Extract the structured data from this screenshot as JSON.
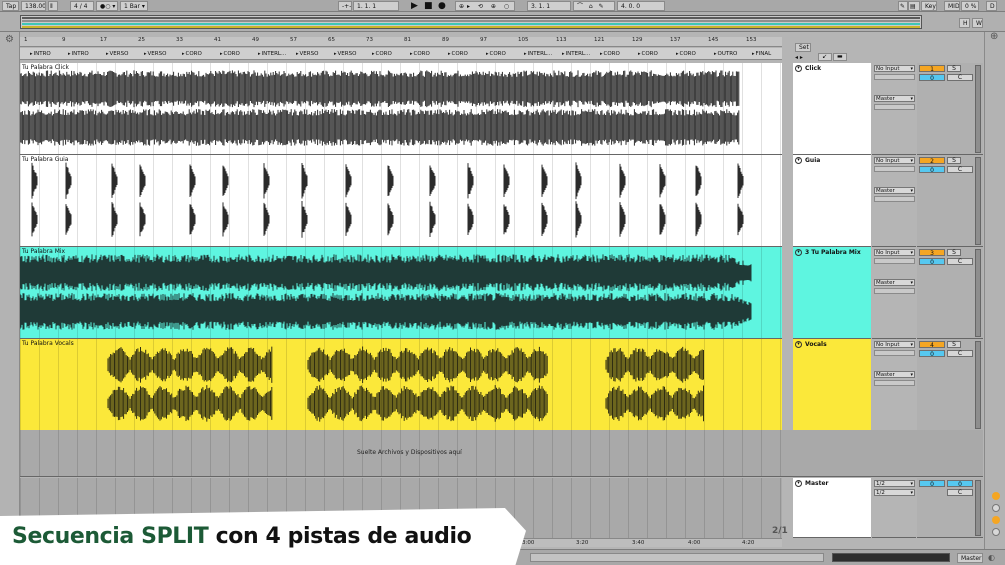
{
  "transport": {
    "tap_label": "Tap",
    "tempo": "138.00",
    "time_signature": "4 / 4",
    "metronome": "●○ ▾",
    "quantize": "1 Bar ▾",
    "arrangement_position": "1.   1.   1",
    "loop_start": "3.   1.   1",
    "loop_length": "4.   0.   0",
    "key_label": "Key",
    "midi_label": "MIDI",
    "cpu": "0 %",
    "disk_label": "D"
  },
  "view_buttons": {
    "h": "H",
    "w": "W",
    "set": "Set"
  },
  "ruler": {
    "bars": [
      "1",
      "9",
      "17",
      "25",
      "33",
      "41",
      "49",
      "57",
      "65",
      "73",
      "81",
      "89",
      "97",
      "105",
      "113",
      "121",
      "129",
      "137",
      "145",
      "153"
    ]
  },
  "locators": [
    "INTRO",
    "INTRO",
    "VERSO",
    "VERSO",
    "CORO",
    "CORO",
    "INTERL...",
    "VERSO",
    "VERSO",
    "CORO",
    "CORO",
    "CORO",
    "CORO",
    "INTERL...",
    "INTERL...",
    "CORO",
    "CORO",
    "CORO",
    "OUTRO",
    "FINAL"
  ],
  "tracks": [
    {
      "clip": "Tu Palabra Click",
      "name": "Click",
      "input": "No Input",
      "output": "Master",
      "number": "1",
      "solo": "S",
      "value": "0",
      "cue": "C",
      "color": "#ffffff",
      "wave_color": "#2b2b2b",
      "wave_type": "dense"
    },
    {
      "clip": "Tu Palabra Guia",
      "name": "Guia",
      "input": "No Input",
      "output": "Master",
      "number": "2",
      "solo": "S",
      "value": "0",
      "cue": "C",
      "color": "#ffffff",
      "wave_color": "#2b2b2b",
      "wave_type": "sparse"
    },
    {
      "clip": "Tu Palabra Mix",
      "name": "3 Tu Palabra Mix",
      "input": "No Input",
      "output": "Master",
      "number": "3",
      "solo": "S",
      "value": "0",
      "cue": "C",
      "color": "#5ef5e0",
      "wave_color": "#1f3a37",
      "wave_type": "full"
    },
    {
      "clip": "Tu Palabra Vocals",
      "name": "Vocals",
      "input": "No Input",
      "output": "Master",
      "number": "4",
      "solo": "S",
      "value": "0",
      "cue": "C",
      "color": "#fbe83a",
      "wave_color": "#2f2d12",
      "wave_type": "vocal"
    }
  ],
  "drop_area": {
    "text": "Suelte Archivos y Dispositivos aquí"
  },
  "master": {
    "name": "Master",
    "in1": "1/2",
    "in2": "1/2",
    "value_a": "0",
    "value_b": "0",
    "cue": "C"
  },
  "time_ruler": [
    "3:00",
    "3:20",
    "3:40",
    "4:00",
    "4:20"
  ],
  "page_indicator": "2/1",
  "status": {
    "master_label": "Master"
  },
  "caption": {
    "highlight": "Secuencia SPLIT",
    "rest": " con 4 pistas de audio"
  },
  "colors": {
    "accent_orange": "#f5a623",
    "accent_blue": "#56c8f0",
    "cyan_track": "#5ef5e0",
    "yellow_track": "#fbe83a",
    "caption_green": "#1c5a36"
  }
}
